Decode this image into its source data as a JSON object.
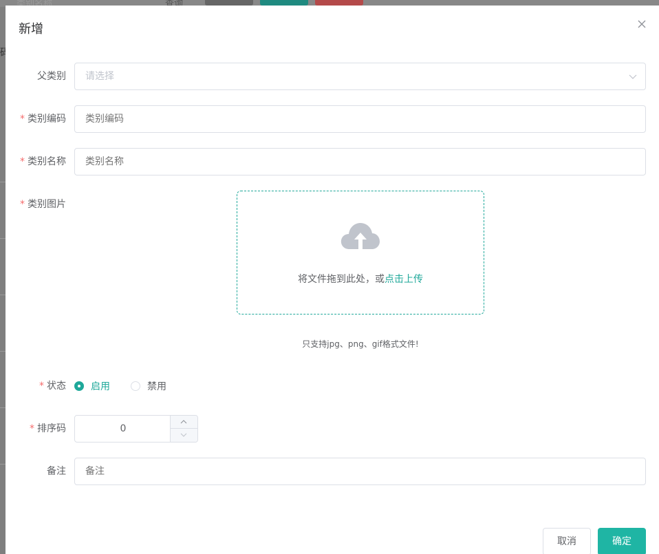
{
  "background": {
    "search_field_placeholder": "类别名称",
    "query_label": "查询",
    "left_edge_text": "码",
    "button_colors": [
      "#666666",
      "#1f8a80",
      "#b44a4a"
    ]
  },
  "dialog": {
    "title": "新增",
    "close_icon": "close-icon"
  },
  "form": {
    "parent": {
      "label": "父类别",
      "placeholder": "请选择",
      "required": false
    },
    "code": {
      "label": "类别编码",
      "placeholder": "类别编码",
      "required": true
    },
    "name": {
      "label": "类别名称",
      "placeholder": "类别名称",
      "required": true
    },
    "image": {
      "label": "类别图片",
      "required": true,
      "drag_text": "将文件拖到此处，或",
      "click_text": "点击上传",
      "tip": "只支持jpg、png、gif格式文件!",
      "icon": "upload-cloud-icon"
    },
    "status": {
      "label": "状态",
      "required": true,
      "options": [
        {
          "label": "启用",
          "checked": true
        },
        {
          "label": "禁用",
          "checked": false
        }
      ]
    },
    "sort": {
      "label": "排序码",
      "value": "0",
      "required": true
    },
    "remark": {
      "label": "备注",
      "placeholder": "备注",
      "required": false
    },
    "required_mark": "*"
  },
  "footer": {
    "cancel_label": "取消",
    "confirm_label": "确定"
  },
  "colors": {
    "accent": "#1fb5a4",
    "required": "#f56c6c",
    "border": "#dcdfe6"
  }
}
